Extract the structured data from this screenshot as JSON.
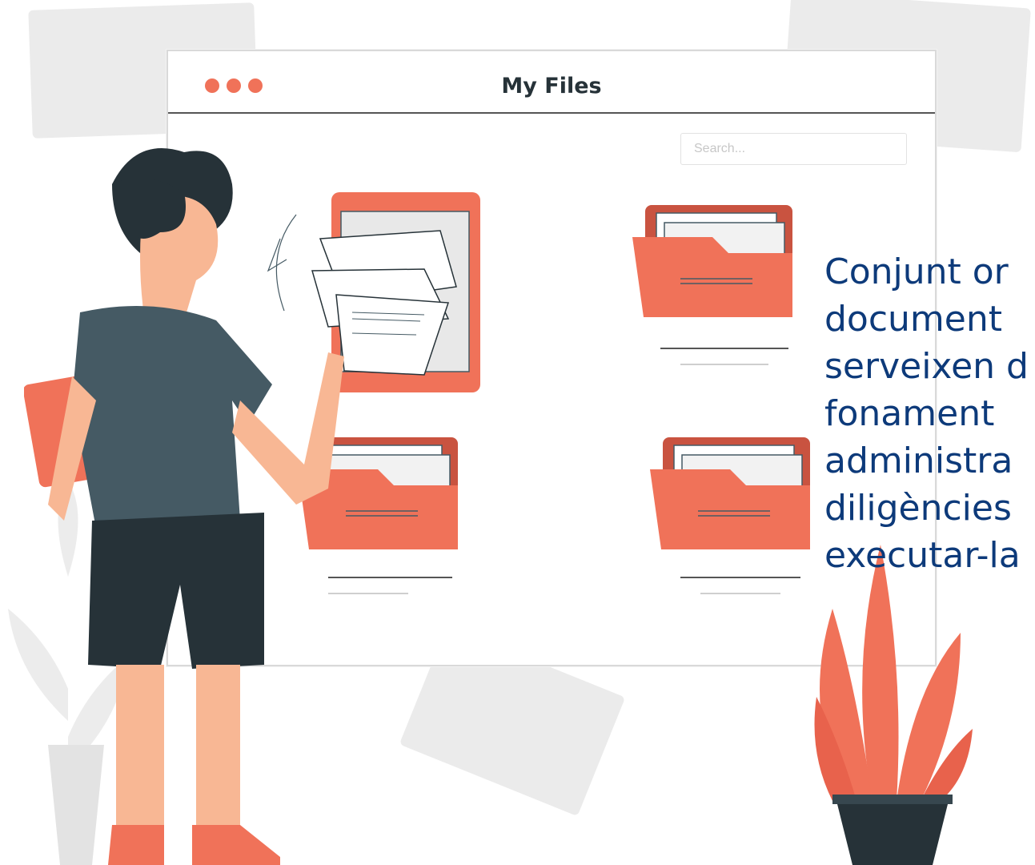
{
  "window": {
    "title": "My  Files",
    "search_placeholder": "Search..."
  },
  "text_lines": [
    "Conjunt or",
    "document",
    "serveixen d",
    "fonament",
    "administra",
    "diligències",
    "executar-la"
  ],
  "colors": {
    "accent": "#f07259",
    "dark": "#263238",
    "text": "#0d3a7a",
    "background_shapes": "#ebebeb"
  },
  "icons": [
    "dot-icon",
    "folder-icon",
    "document-icon",
    "plant-icon",
    "person-illustration"
  ]
}
